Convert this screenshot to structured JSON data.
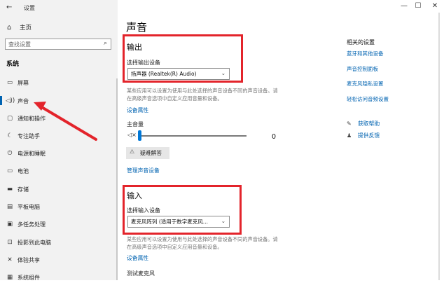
{
  "window": {
    "title": "设置",
    "back_glyph": "←",
    "minimize_glyph": "—",
    "maximize_glyph": "☐",
    "close_glyph": "✕"
  },
  "sidebar": {
    "home_label": "主页",
    "search_placeholder": "查找设置",
    "section_label": "系统",
    "items": [
      {
        "label": "屏幕",
        "icon": "monitor-icon"
      },
      {
        "label": "声音",
        "icon": "speaker-icon",
        "active": true
      },
      {
        "label": "通知和操作",
        "icon": "notification-icon"
      },
      {
        "label": "专注助手",
        "icon": "moon-icon"
      },
      {
        "label": "电源和睡眠",
        "icon": "power-icon"
      },
      {
        "label": "电池",
        "icon": "battery-icon"
      },
      {
        "label": "存储",
        "icon": "storage-icon"
      },
      {
        "label": "平板电脑",
        "icon": "tablet-icon"
      },
      {
        "label": "多任务处理",
        "icon": "multitask-icon"
      },
      {
        "label": "投影到此电脑",
        "icon": "project-icon"
      },
      {
        "label": "体验共享",
        "icon": "share-icon"
      },
      {
        "label": "系统组件",
        "icon": "components-icon"
      }
    ]
  },
  "main": {
    "title": "声音",
    "output": {
      "heading": "输出",
      "device_label": "选择输出设备",
      "device_value": "扬声器 (Realtek(R) Audio)",
      "desc_line1": "某些应用可以设置为使用与此处选择的声音设备不同的声音设备。请",
      "desc_line2": "在高级声音选项中自定义应用音量和设备。",
      "device_props_link": "设备属性",
      "volume_label": "主音量",
      "volume_value": "0",
      "troubleshoot_label": "疑难解答",
      "manage_link": "管理声音设备"
    },
    "input": {
      "heading": "输入",
      "device_label": "选择输入设备",
      "device_value": "麦克风阵列 (适用于数字麦克风...",
      "desc_line1": "某些应用可以设置为使用与此处选择的声音设备不同的声音设备。请",
      "desc_line2": "在高级声音选项中自定义应用音量和设备。",
      "device_props_link": "设备属性",
      "test_label": "测试麦克风"
    }
  },
  "related": {
    "title": "相关的设置",
    "links": [
      "蓝牙和其他设备",
      "声音控制面板",
      "麦克风隐私设置",
      "轻松访问音频设置"
    ],
    "help": [
      {
        "label": "获取帮助",
        "icon": "help-icon"
      },
      {
        "label": "提供反馈",
        "icon": "feedback-icon"
      }
    ]
  },
  "colors": {
    "accent": "#0063b1",
    "highlight_red": "#e3242b",
    "sidebar_bg": "#f2f2f2"
  }
}
